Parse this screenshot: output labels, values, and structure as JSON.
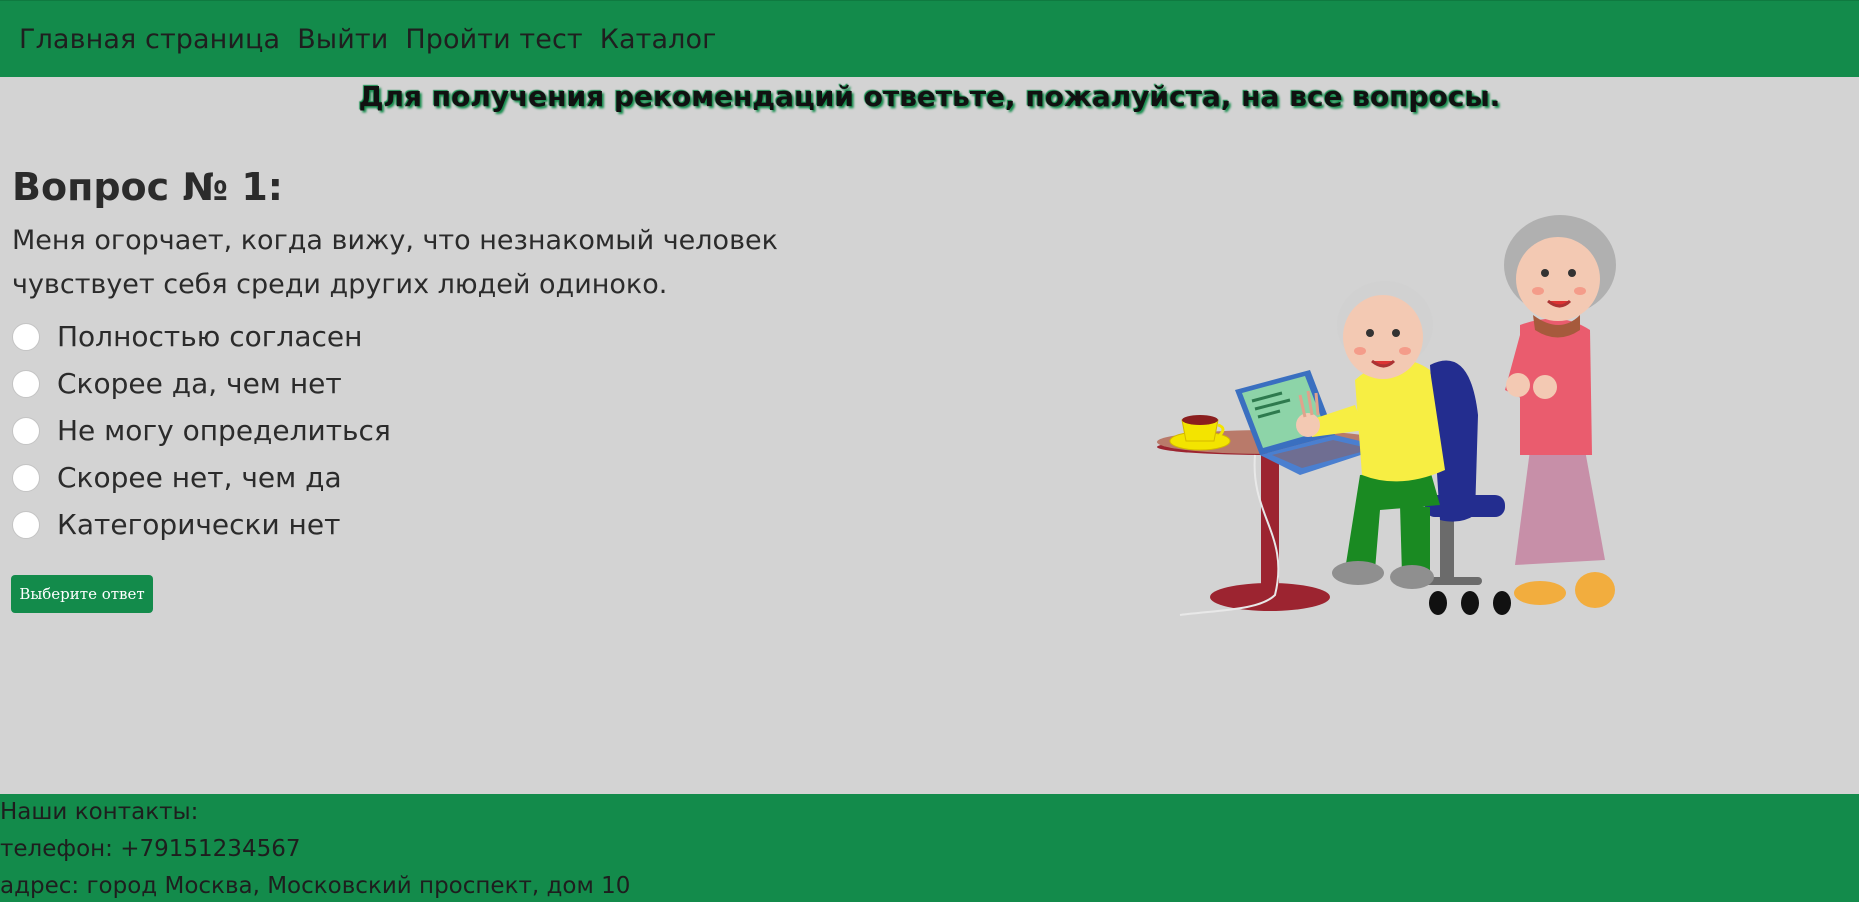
{
  "nav": {
    "items": [
      {
        "label": "Главная страница"
      },
      {
        "label": "Выйти"
      },
      {
        "label": "Пройти тест"
      },
      {
        "label": "Каталог"
      }
    ]
  },
  "banner": {
    "text": "Для получения рекомендаций ответьте, пожалуйста, на все вопросы."
  },
  "question": {
    "title": "Вопрос № 1:",
    "text": "Меня огорчает, когда вижу, что незнакомый человек чувствует себя среди других людей одиноко.",
    "options": [
      {
        "label": "Полностью согласен"
      },
      {
        "label": "Скорее да, чем нет"
      },
      {
        "label": "Не могу определиться"
      },
      {
        "label": "Скорее нет, чем да"
      },
      {
        "label": "Категорически нет"
      }
    ],
    "submit_label": "Выберите ответ"
  },
  "illustration": {
    "icon": "elderly-couple-laptop-illustration"
  },
  "footer": {
    "heading": "Наши контакты:",
    "phone": "телефон: +79151234567",
    "address": "адрес: город Москва, Московский проспект, дом 10"
  },
  "colors": {
    "brand_green": "#138b4b",
    "background": "#d3d3d3"
  }
}
